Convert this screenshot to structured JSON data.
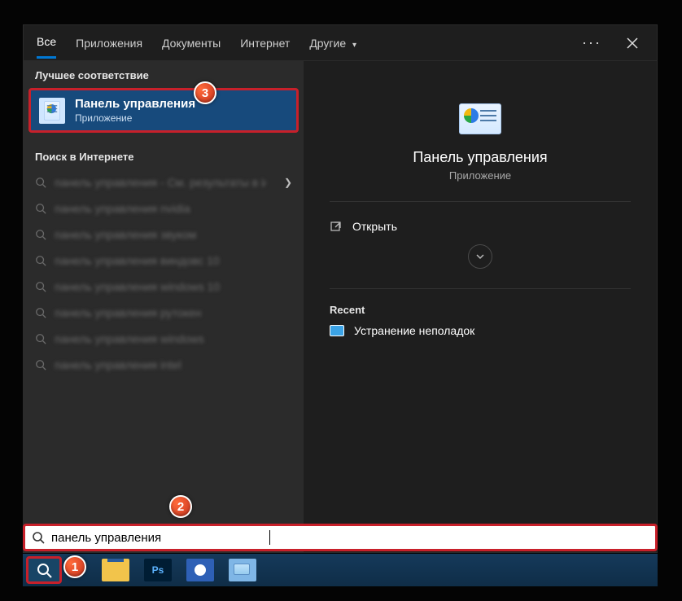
{
  "tabs": {
    "all": "Все",
    "apps": "Приложения",
    "documents": "Документы",
    "internet": "Интернет",
    "other": "Другие"
  },
  "left": {
    "best_match_header": "Лучшее соответствие",
    "best_match_title": "Панель управления",
    "best_match_sub": "Приложение",
    "web_header": "Поиск в Интернете",
    "web_items": [
      "панель управления - См. результаты в Интернете",
      "панель управления nvidia",
      "панель управления звуком",
      "панель управления виндовс 10",
      "панель управления windows 10",
      "панель управления рутокен",
      "панель управления windows",
      "панель управления intel"
    ]
  },
  "detail": {
    "title": "Панель управления",
    "subtitle": "Приложение",
    "open_label": "Открыть",
    "recent_header": "Recent",
    "recent_item": "Устранение неполадок"
  },
  "search": {
    "query_value": "панель управления"
  },
  "badges": {
    "b1": "1",
    "b2": "2",
    "b3": "3"
  }
}
